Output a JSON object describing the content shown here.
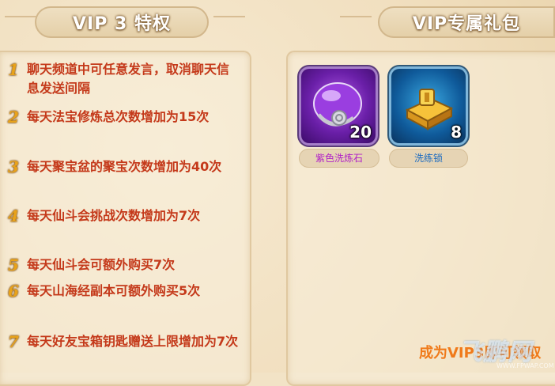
{
  "headers": {
    "left_title": "VIP 3 特权",
    "right_title": "VIP专属礼包"
  },
  "privileges": [
    {
      "num": "1",
      "text": "聊天频道中可任意发言，取消聊天信息发送间隔"
    },
    {
      "num": "2",
      "text": "每天法宝修炼总次数增加为15次"
    },
    {
      "num": "3",
      "text": "每天聚宝盆的聚宝次数增加为40次"
    },
    {
      "num": "4",
      "text": "每天仙斗会挑战次数增加为7次"
    },
    {
      "num": "5",
      "text": "每天仙斗会可额外购买7次"
    },
    {
      "num": "6",
      "text": "每天山海经副本可额外购买5次"
    },
    {
      "num": "7",
      "text": "每天好友宝箱钥匙赠送上限增加为7次"
    }
  ],
  "gifts": [
    {
      "name": "紫色洗炼石",
      "qty": "20",
      "icon": "purple-orb-stone-icon"
    },
    {
      "name": "洗练锁",
      "qty": "8",
      "icon": "gold-lock-icon"
    }
  ],
  "footer": {
    "text": "成为VIP3即可领取"
  },
  "watermark": {
    "main": "飞鹏网",
    "sub": "WWW.FPWAP.COM"
  }
}
